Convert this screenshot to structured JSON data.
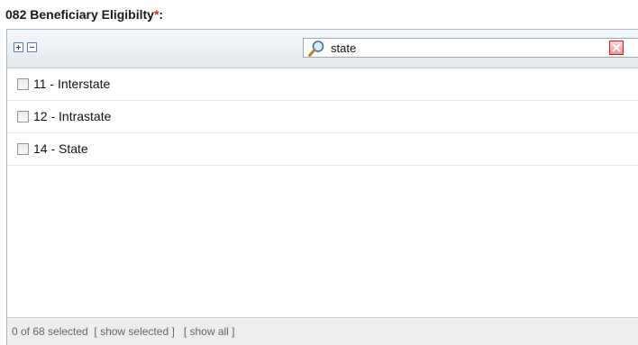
{
  "field": {
    "label": "082 Beneficiary Eligibilty",
    "required_mark": "*",
    "label_suffix": ":"
  },
  "toolbar": {
    "expand_icon": "plus-box-icon",
    "collapse_icon": "minus-box-icon"
  },
  "search": {
    "icon": "magnifier-icon",
    "value": "state",
    "clear_icon": "red-x-icon"
  },
  "options": [
    {
      "label": "11 - Interstate",
      "checked": false
    },
    {
      "label": "12 - Intrastate",
      "checked": false
    },
    {
      "label": "14 - State",
      "checked": false
    }
  ],
  "footer": {
    "count_text": "0 of 68 selected",
    "show_selected": "[ show selected ]",
    "show_all": "[ show all ]"
  },
  "colors": {
    "required": "#e0202a",
    "border": "#a9b7c6",
    "footer_bg": "#ededed"
  }
}
